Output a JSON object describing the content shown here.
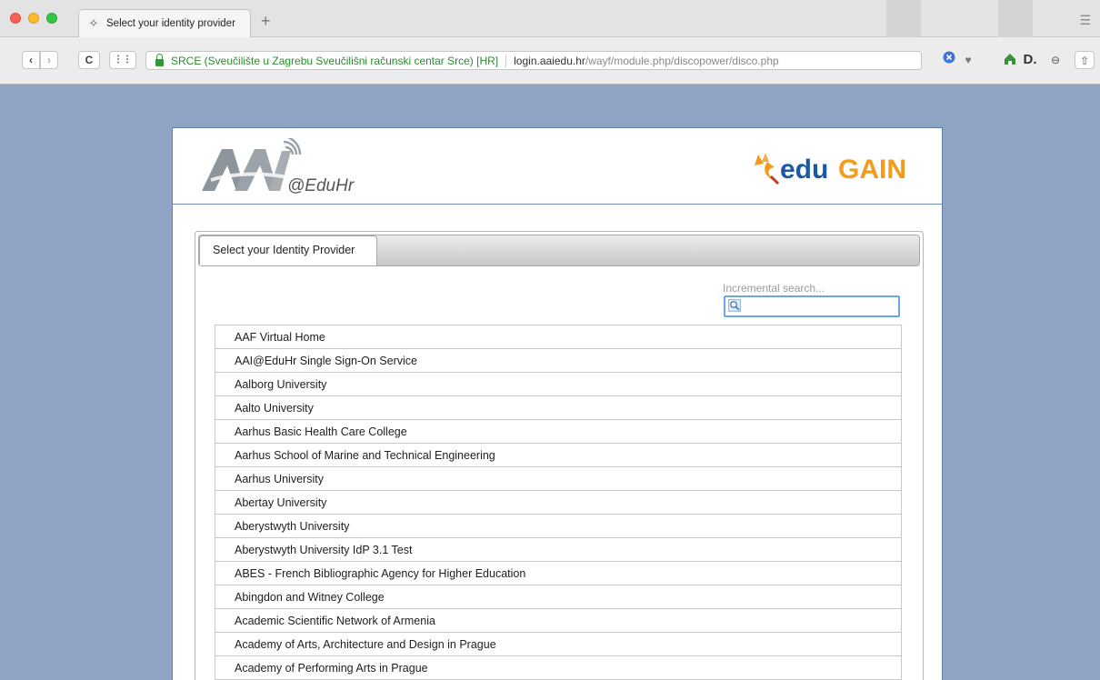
{
  "browser": {
    "tab_title": "Select your identity provider",
    "new_tab_icon": "plus-icon",
    "cert_label": "SRCE (Sveučilište u Zagrebu Sveučilišni računski centar Srce) [HR]",
    "url_host": "login.aaiedu.hr",
    "url_path": "/wayf/module.php/discopower/disco.php",
    "extensions": [
      "shield-icon",
      "heart-icon",
      "home-icon",
      "d-icon",
      "profile-icon",
      "share-icon"
    ]
  },
  "header": {
    "logo_left_text": "@EduHr",
    "logo_right_prefix": "edu",
    "logo_right_suffix": "GAIN",
    "colors": {
      "edu": "#1b5aa3",
      "gain": "#f29b1c"
    }
  },
  "panel": {
    "tab_label": "Select your Identity Provider",
    "search_placeholder": "Incremental search..."
  },
  "providers": [
    "AAF Virtual Home",
    "AAI@EduHr Single Sign-On Service",
    "Aalborg University",
    "Aalto University",
    "Aarhus Basic Health Care College",
    "Aarhus School of Marine and Technical Engineering",
    "Aarhus University",
    "Abertay University",
    "Aberystwyth University",
    "Aberystwyth University IdP 3.1 Test",
    "ABES - French Bibliographic Agency for Higher Education",
    "Abingdon and Witney College",
    "Academic Scientific Network of Armenia",
    "Academy of Arts, Architecture and Design in Prague",
    "Academy of Performing Arts in Prague"
  ]
}
